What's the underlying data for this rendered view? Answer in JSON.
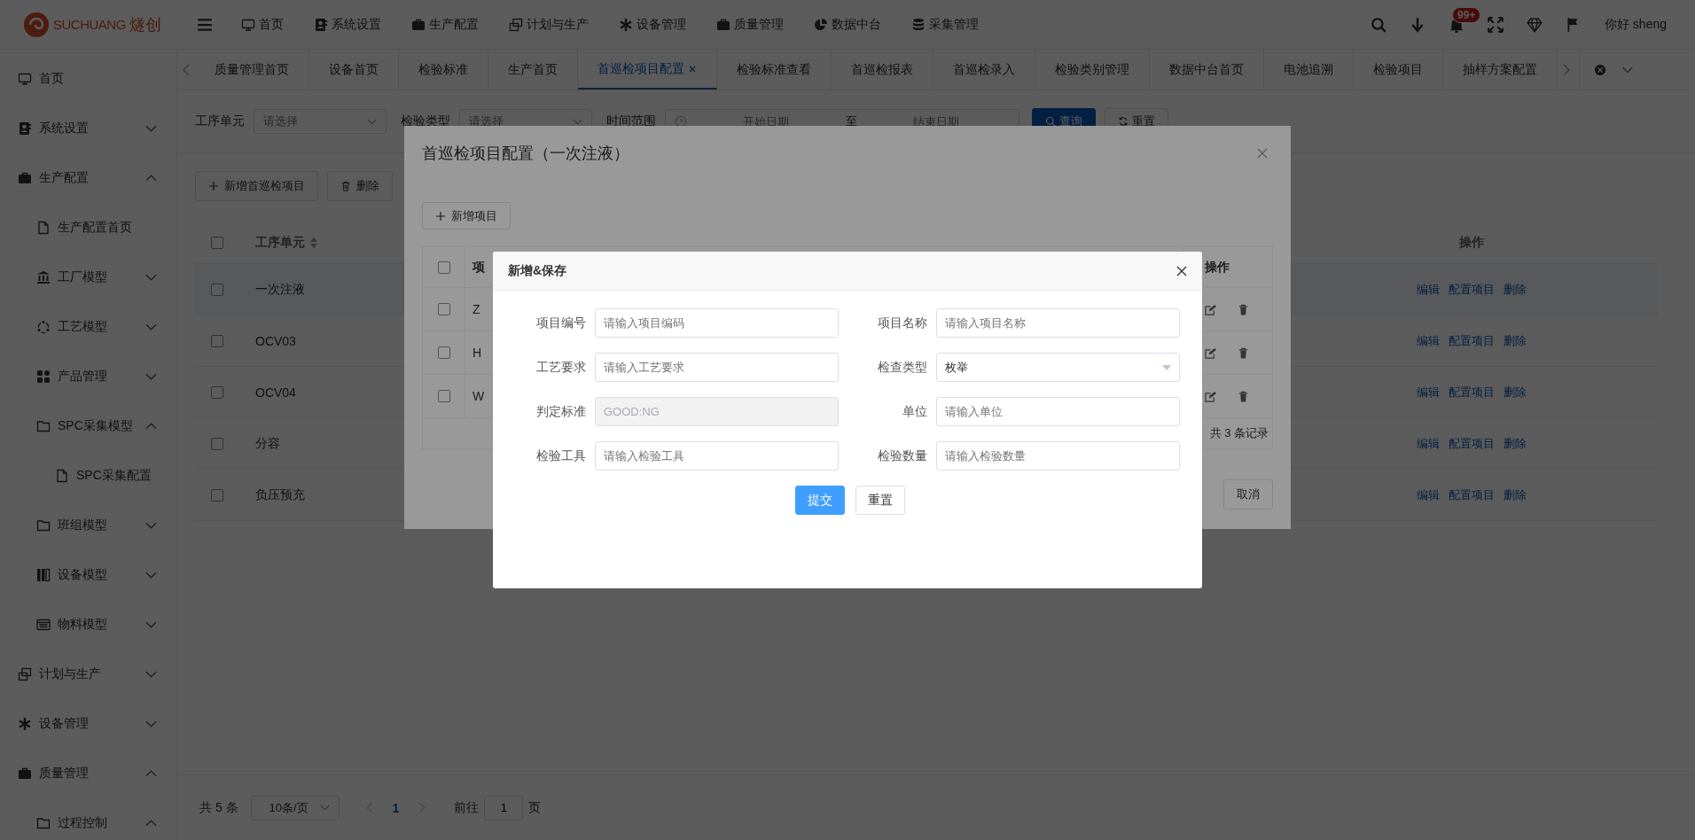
{
  "header": {
    "logo": {
      "brand": "SUCHUANG",
      "brand_cn": "燧创"
    },
    "nav": [
      {
        "label": "首页"
      },
      {
        "label": "系统设置"
      },
      {
        "label": "生产配置"
      },
      {
        "label": "计划与生产"
      },
      {
        "label": "设备管理"
      },
      {
        "label": "质量管理"
      },
      {
        "label": "数据中台"
      },
      {
        "label": "采集管理"
      }
    ],
    "notification_badge": "99+",
    "greeting": "你好 sheng"
  },
  "tabs": [
    {
      "label": "质量管理首页",
      "selected": false
    },
    {
      "label": "设备首页",
      "selected": false
    },
    {
      "label": "检验标准",
      "selected": false
    },
    {
      "label": "生产首页",
      "selected": false
    },
    {
      "label": "首巡检项目配置",
      "selected": true
    },
    {
      "label": "检验标准查看",
      "selected": false
    },
    {
      "label": "首巡检报表",
      "selected": false
    },
    {
      "label": "首巡检录入",
      "selected": false
    },
    {
      "label": "检验类别管理",
      "selected": false
    },
    {
      "label": "数据中台首页",
      "selected": false
    },
    {
      "label": "电池追溯",
      "selected": false
    },
    {
      "label": "检验项目",
      "selected": false
    },
    {
      "label": "抽样方案配置",
      "selected": false
    }
  ],
  "sidebar": {
    "items": [
      {
        "label": "首页",
        "kind": "page"
      },
      {
        "label": "系统设置",
        "kind": "menu",
        "expanded": false
      },
      {
        "label": "生产配置",
        "kind": "menu",
        "expanded": true,
        "children": [
          {
            "label": "生产配置首页",
            "kind": "page"
          },
          {
            "label": "工厂模型",
            "kind": "menu",
            "expanded": false
          },
          {
            "label": "工艺模型",
            "kind": "menu",
            "expanded": false
          },
          {
            "label": "产品管理",
            "kind": "menu",
            "expanded": false
          },
          {
            "label": "SPC采集模型",
            "kind": "menu",
            "expanded": true,
            "children": [
              {
                "label": "SPC采集配置",
                "kind": "page"
              }
            ]
          },
          {
            "label": "班组模型",
            "kind": "menu",
            "expanded": false
          },
          {
            "label": "设备模型",
            "kind": "menu",
            "expanded": false
          },
          {
            "label": "物料模型",
            "kind": "menu",
            "expanded": false
          }
        ]
      },
      {
        "label": "计划与生产",
        "kind": "menu",
        "expanded": false
      },
      {
        "label": "设备管理",
        "kind": "menu",
        "expanded": false
      },
      {
        "label": "质量管理",
        "kind": "menu",
        "expanded": true,
        "children": [
          {
            "label": "过程控制",
            "kind": "menu",
            "expanded": true
          }
        ]
      }
    ]
  },
  "filters": {
    "process_unit": {
      "label": "工序单元",
      "placeholder": "请选择"
    },
    "inspection_type": {
      "label": "检验类型",
      "placeholder": "请选择"
    },
    "time_range": {
      "label": "时间范围",
      "start_placeholder": "开始日期",
      "separator": "至",
      "end_placeholder": "结束日期"
    },
    "buttons": [
      {
        "label": "查询",
        "kind": "primary"
      },
      {
        "label": "重置",
        "kind": "default"
      }
    ]
  },
  "toolbar": [
    {
      "label": "新增首巡检项目",
      "kind": "add"
    },
    {
      "label": "删除",
      "kind": "delete"
    }
  ],
  "table": {
    "all_checked": false,
    "columns": [
      "工序单元",
      "操作"
    ],
    "rows": [
      {
        "process_unit": "一次注液",
        "selected": true,
        "checked": false,
        "actions": [
          "编辑",
          "配置项目",
          "删除"
        ]
      },
      {
        "process_unit": "OCV03",
        "selected": false,
        "checked": false,
        "actions": [
          "编辑",
          "配置项目",
          "删除"
        ]
      },
      {
        "process_unit": "OCV04",
        "selected": false,
        "checked": false,
        "actions": [
          "编辑",
          "配置项目",
          "删除"
        ]
      },
      {
        "process_unit": "分容",
        "selected": false,
        "checked": false,
        "actions": [
          "编辑",
          "配置项目",
          "删除"
        ]
      },
      {
        "process_unit": "负压预充",
        "selected": false,
        "checked": false,
        "actions": [
          "编辑",
          "配置项目",
          "删除"
        ]
      }
    ]
  },
  "pagination": {
    "total": "共 5 条",
    "page_size": "10条/页",
    "pages": [
      {
        "label": "1",
        "selected": true
      }
    ],
    "goto_label": "前往",
    "goto_value": "1",
    "page_suffix": "页"
  },
  "config_dialog": {
    "title": "首巡检项目配置（一次注液）",
    "add_button": "新增项目",
    "table": {
      "all_checked": false,
      "columns": [
        "项",
        "操作"
      ],
      "rows": [
        {
          "cell": "Z",
          "checked": false
        },
        {
          "cell": "H",
          "checked": false
        },
        {
          "cell": "W",
          "checked": false
        }
      ],
      "footer": "共 3 条记录"
    },
    "cancel_button": "取消"
  },
  "form_dialog": {
    "title": "新增&保存",
    "fields": [
      {
        "label": "项目编号",
        "kind": "input",
        "placeholder": "请输入项目编码",
        "disabled": false
      },
      {
        "label": "项目名称",
        "kind": "input",
        "placeholder": "请输入项目名称",
        "disabled": false
      },
      {
        "label": "工艺要求",
        "kind": "input",
        "placeholder": "请输入工艺要求",
        "disabled": false
      },
      {
        "label": "检查类型",
        "kind": "select",
        "value": "枚举",
        "disabled": false
      },
      {
        "label": "判定标准",
        "kind": "input",
        "value": "GOOD:NG",
        "disabled": true
      },
      {
        "label": "单位",
        "kind": "input",
        "placeholder": "请输入单位",
        "disabled": false
      },
      {
        "label": "检验工具",
        "kind": "input",
        "placeholder": "请输入检验工具",
        "disabled": false
      },
      {
        "label": "检验数量",
        "kind": "input",
        "placeholder": "请输入检验数量",
        "disabled": false
      }
    ],
    "buttons": [
      {
        "label": "提交",
        "kind": "primary"
      },
      {
        "label": "重置",
        "kind": "default"
      }
    ]
  }
}
